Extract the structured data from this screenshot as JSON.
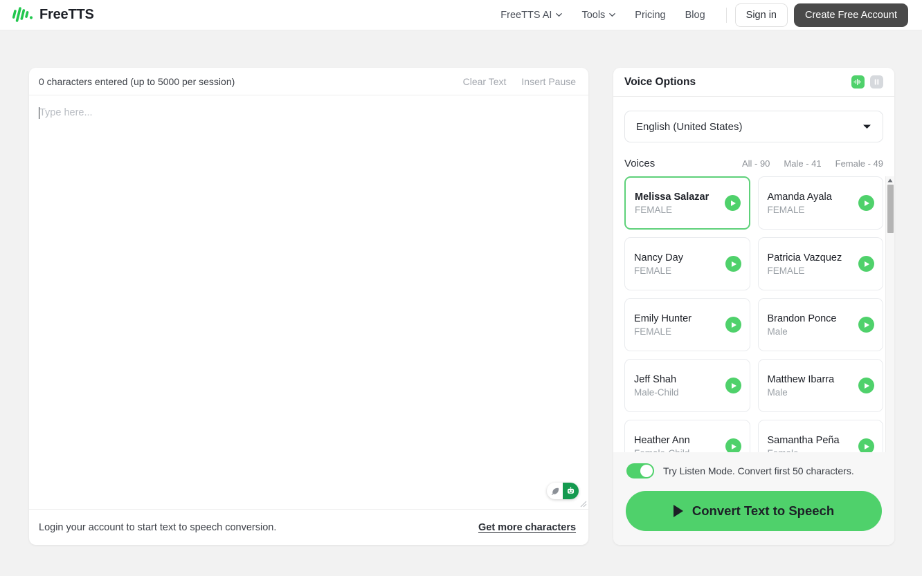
{
  "header": {
    "brand": "FreeTTS",
    "logo_icon": "waveform-logo-icon",
    "nav": [
      {
        "label": "FreeTTS AI",
        "has_caret": true
      },
      {
        "label": "Tools",
        "has_caret": true
      },
      {
        "label": "Pricing",
        "has_caret": false
      },
      {
        "label": "Blog",
        "has_caret": false
      }
    ],
    "sign_in": "Sign in",
    "create_account": "Create Free Account"
  },
  "editor": {
    "char_count": "0 characters entered (up to 5000 per session)",
    "clear_text": "Clear Text",
    "insert_pause": "Insert Pause",
    "placeholder": "Type here...",
    "value": "",
    "login_note": "Login your account to start text to speech conversion.",
    "get_more": "Get more characters",
    "assistant_icons": [
      "feather-icon",
      "robot-icon"
    ]
  },
  "voice_panel": {
    "title": "Voice Options",
    "mode_voice_icon": "waveform-icon",
    "mode_dialogue_icon": "dialogue-icon",
    "language": "English (United States)",
    "voices_label": "Voices",
    "filters": [
      {
        "label": "All - 90"
      },
      {
        "label": "Male - 41"
      },
      {
        "label": "Female - 49"
      }
    ],
    "voices": [
      {
        "name": "Melissa Salazar",
        "gender": "FEMALE",
        "selected": true
      },
      {
        "name": "Amanda Ayala",
        "gender": "FEMALE",
        "selected": false
      },
      {
        "name": "Nancy Day",
        "gender": "FEMALE",
        "selected": false
      },
      {
        "name": "Patricia Vazquez",
        "gender": "FEMALE",
        "selected": false
      },
      {
        "name": "Emily Hunter",
        "gender": "FEMALE",
        "selected": false
      },
      {
        "name": "Brandon Ponce",
        "gender": "Male",
        "selected": false
      },
      {
        "name": "Jeff Shah",
        "gender": "Male-Child",
        "selected": false
      },
      {
        "name": "Matthew Ibarra",
        "gender": "Male",
        "selected": false
      },
      {
        "name": "Heather Ann",
        "gender": "Female-Child",
        "selected": false
      },
      {
        "name": "Samantha Peña",
        "gender": "Female",
        "selected": false
      }
    ],
    "listen_mode_text": "Try Listen Mode. Convert first 50 characters.",
    "listen_mode_on": true,
    "convert_button": "Convert Text to Speech"
  },
  "colors": {
    "accent_green": "#4fd16b",
    "logo_green": "#22c74e",
    "dark_button": "#4a4a4a",
    "page_bg": "#f2f2f2"
  }
}
